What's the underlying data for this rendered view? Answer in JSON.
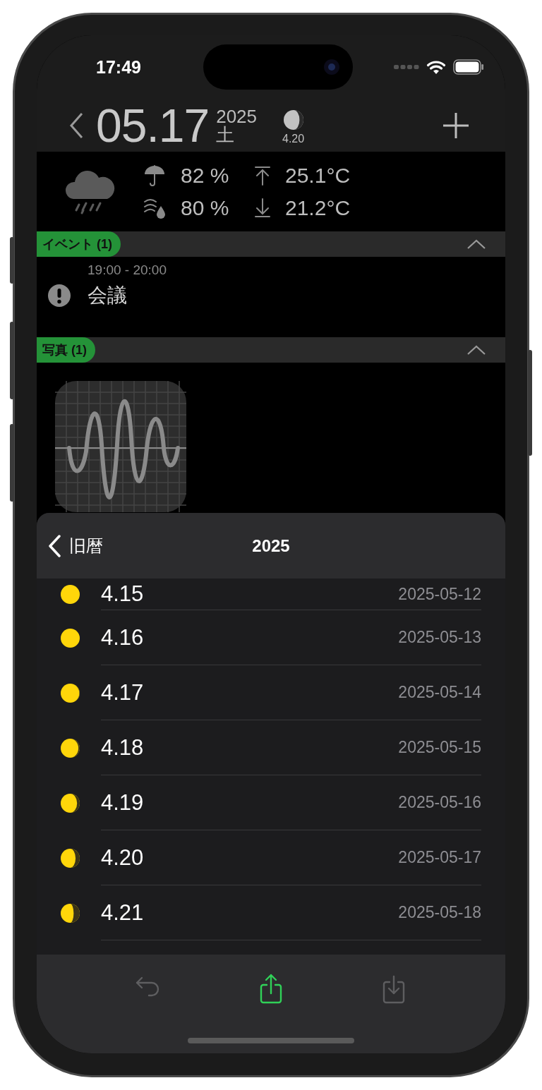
{
  "status_bar": {
    "time": "17:49"
  },
  "header": {
    "date": "05.17",
    "year": "2025",
    "weekday": "土",
    "moon": {
      "lunar_date": "4.20"
    }
  },
  "weather": {
    "precipitation": "82 %",
    "humidity": "80 %",
    "high": "25.1°C",
    "low": "21.2°C"
  },
  "sections": [
    {
      "title": "イベント (1)",
      "expanded": true,
      "kind": "events",
      "events": [
        {
          "time": "19:00 - 20:00",
          "title": "会議"
        }
      ]
    },
    {
      "title": "写真 (1)",
      "expanded": true,
      "kind": "photos"
    }
  ],
  "sheet": {
    "back_label": "旧暦",
    "title": "2025",
    "rows": [
      {
        "lunar": "4.15",
        "date": "2025-05-12"
      },
      {
        "lunar": "4.16",
        "date": "2025-05-13"
      },
      {
        "lunar": "4.17",
        "date": "2025-05-14"
      },
      {
        "lunar": "4.18",
        "date": "2025-05-15"
      },
      {
        "lunar": "4.19",
        "date": "2025-05-16"
      },
      {
        "lunar": "4.20",
        "date": "2025-05-17"
      },
      {
        "lunar": "4.21",
        "date": "2025-05-18"
      }
    ]
  },
  "toolbar": [
    {
      "kind": "undo",
      "disabled": true
    },
    {
      "kind": "share",
      "disabled": false
    },
    {
      "kind": "download",
      "disabled": true
    }
  ]
}
